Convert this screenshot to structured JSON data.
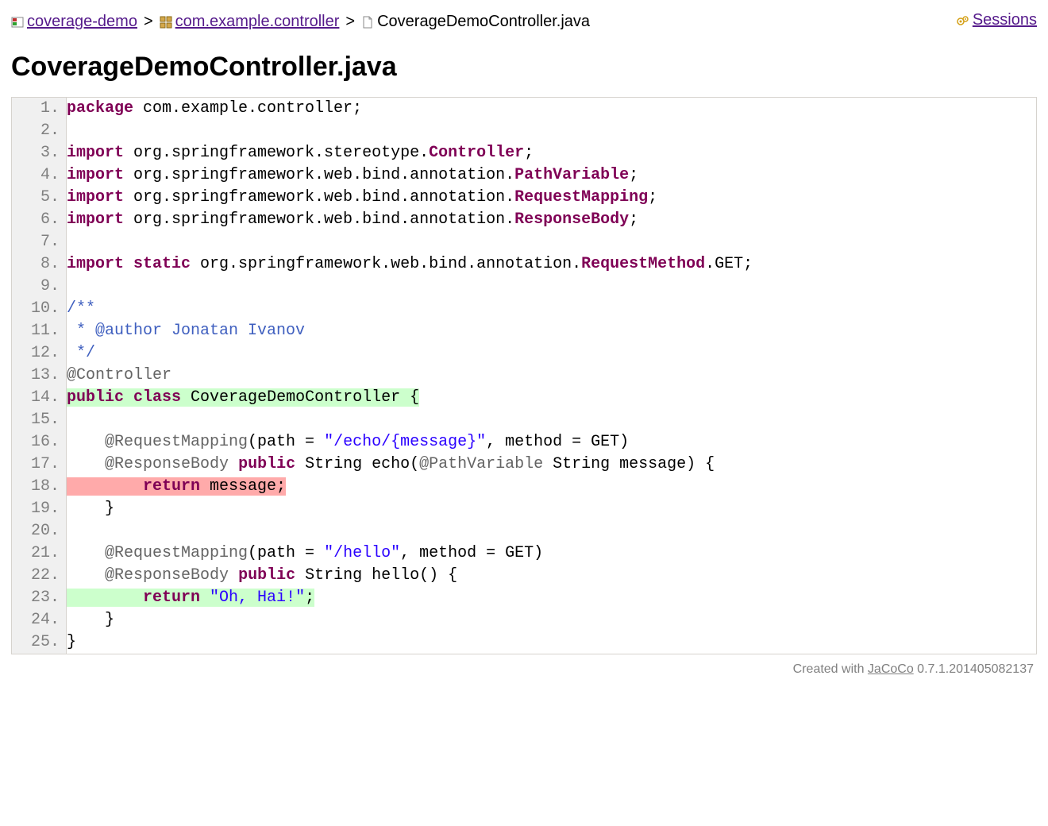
{
  "breadcrumb": {
    "items": [
      {
        "label": "coverage-demo",
        "icon": "report"
      },
      {
        "label": "com.example.controller",
        "icon": "package"
      }
    ],
    "current": {
      "label": "CoverageDemoController.java",
      "icon": "java"
    },
    "sessions": "Sessions"
  },
  "title": "CoverageDemoController.java",
  "code_lines": [
    {
      "n": 1,
      "tokens": [
        {
          "t": "package",
          "c": "kw"
        },
        {
          "t": " com.example.controller;"
        }
      ]
    },
    {
      "n": 2,
      "tokens": []
    },
    {
      "n": 3,
      "tokens": [
        {
          "t": "import",
          "c": "kw"
        },
        {
          "t": " org.springframework.stereotype."
        },
        {
          "t": "Controller",
          "c": "kw"
        },
        {
          "t": ";"
        }
      ]
    },
    {
      "n": 4,
      "tokens": [
        {
          "t": "import",
          "c": "kw"
        },
        {
          "t": " org.springframework.web.bind.annotation."
        },
        {
          "t": "PathVariable",
          "c": "kw"
        },
        {
          "t": ";"
        }
      ]
    },
    {
      "n": 5,
      "tokens": [
        {
          "t": "import",
          "c": "kw"
        },
        {
          "t": " org.springframework.web.bind.annotation."
        },
        {
          "t": "RequestMapping",
          "c": "kw"
        },
        {
          "t": ";"
        }
      ]
    },
    {
      "n": 6,
      "tokens": [
        {
          "t": "import",
          "c": "kw"
        },
        {
          "t": " org.springframework.web.bind.annotation."
        },
        {
          "t": "ResponseBody",
          "c": "kw"
        },
        {
          "t": ";"
        }
      ]
    },
    {
      "n": 7,
      "tokens": []
    },
    {
      "n": 8,
      "tokens": [
        {
          "t": "import",
          "c": "kw"
        },
        {
          "t": " "
        },
        {
          "t": "static",
          "c": "kw"
        },
        {
          "t": " org.springframework.web.bind.annotation."
        },
        {
          "t": "RequestMethod",
          "c": "kw"
        },
        {
          "t": ".GET;"
        }
      ]
    },
    {
      "n": 9,
      "tokens": []
    },
    {
      "n": 10,
      "tokens": [
        {
          "t": "/**",
          "c": "com"
        }
      ]
    },
    {
      "n": 11,
      "tokens": [
        {
          "t": " * @author Jonatan Ivanov",
          "c": "com"
        }
      ]
    },
    {
      "n": 12,
      "tokens": [
        {
          "t": " */",
          "c": "com"
        }
      ]
    },
    {
      "n": 13,
      "tokens": [
        {
          "t": "@Controller",
          "c": "ann"
        }
      ]
    },
    {
      "n": 14,
      "cov": "full",
      "tokens": [
        {
          "t": "public",
          "c": "kw"
        },
        {
          "t": " "
        },
        {
          "t": "class",
          "c": "kw"
        },
        {
          "t": " CoverageDemoController {"
        }
      ]
    },
    {
      "n": 15,
      "tokens": []
    },
    {
      "n": 16,
      "tokens": [
        {
          "t": "    "
        },
        {
          "t": "@RequestMapping",
          "c": "ann"
        },
        {
          "t": "(path = "
        },
        {
          "t": "\"/echo/{message}\"",
          "c": "str"
        },
        {
          "t": ", method = GET)"
        }
      ]
    },
    {
      "n": 17,
      "tokens": [
        {
          "t": "    "
        },
        {
          "t": "@ResponseBody",
          "c": "ann"
        },
        {
          "t": " "
        },
        {
          "t": "public",
          "c": "kw"
        },
        {
          "t": " String echo("
        },
        {
          "t": "@PathVariable",
          "c": "ann"
        },
        {
          "t": " String message) {"
        }
      ]
    },
    {
      "n": 18,
      "cov": "none",
      "tokens": [
        {
          "t": "        "
        },
        {
          "t": "return",
          "c": "kw"
        },
        {
          "t": " message;"
        }
      ]
    },
    {
      "n": 19,
      "tokens": [
        {
          "t": "    }"
        }
      ]
    },
    {
      "n": 20,
      "tokens": []
    },
    {
      "n": 21,
      "tokens": [
        {
          "t": "    "
        },
        {
          "t": "@RequestMapping",
          "c": "ann"
        },
        {
          "t": "(path = "
        },
        {
          "t": "\"/hello\"",
          "c": "str"
        },
        {
          "t": ", method = GET)"
        }
      ]
    },
    {
      "n": 22,
      "tokens": [
        {
          "t": "    "
        },
        {
          "t": "@ResponseBody",
          "c": "ann"
        },
        {
          "t": " "
        },
        {
          "t": "public",
          "c": "kw"
        },
        {
          "t": " String hello() {"
        }
      ]
    },
    {
      "n": 23,
      "cov": "full",
      "tokens": [
        {
          "t": "        "
        },
        {
          "t": "return",
          "c": "kw"
        },
        {
          "t": " "
        },
        {
          "t": "\"Oh, Hai!\"",
          "c": "str"
        },
        {
          "t": ";"
        }
      ]
    },
    {
      "n": 24,
      "tokens": [
        {
          "t": "    }"
        }
      ]
    },
    {
      "n": 25,
      "tokens": [
        {
          "t": "}"
        }
      ]
    }
  ],
  "footer": {
    "prefix": "Created with ",
    "link": "JaCoCo",
    "version": " 0.7.1.201405082137"
  }
}
